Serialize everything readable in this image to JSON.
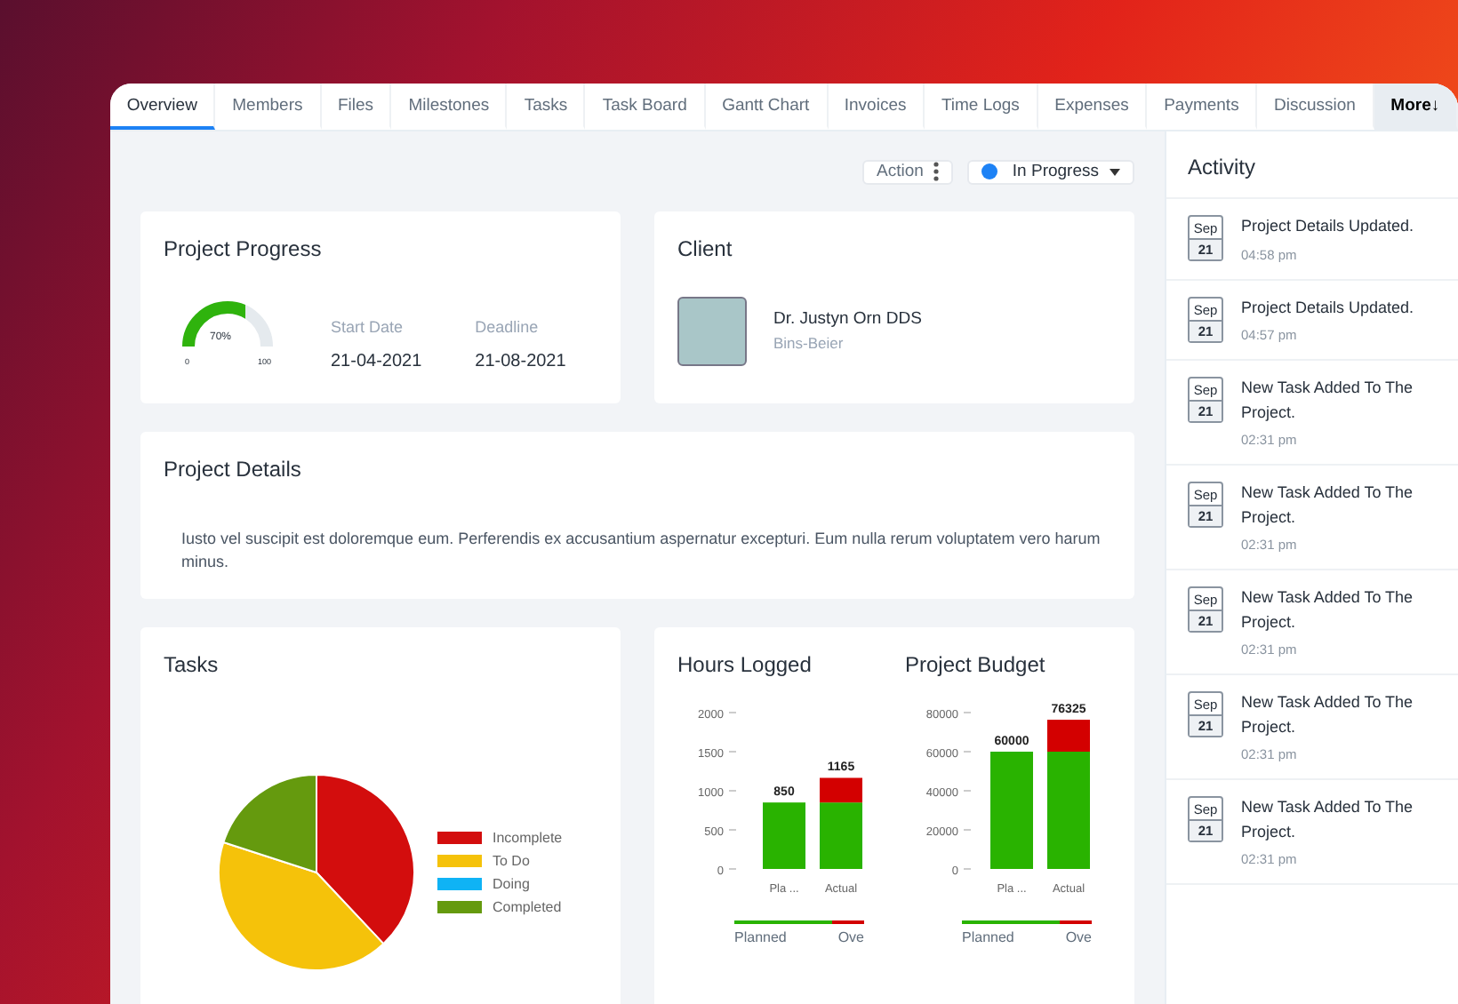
{
  "tabs": [
    {
      "label": "Overview",
      "selected": true
    },
    {
      "label": "Members",
      "selected": false
    },
    {
      "label": "Files",
      "selected": false
    },
    {
      "label": "Milestones",
      "selected": false
    },
    {
      "label": "Tasks",
      "selected": false
    },
    {
      "label": "Task Board",
      "selected": false
    },
    {
      "label": "Gantt Chart",
      "selected": false
    },
    {
      "label": "Invoices",
      "selected": false
    },
    {
      "label": "Time Logs",
      "selected": false
    },
    {
      "label": "Expenses",
      "selected": false
    },
    {
      "label": "Payments",
      "selected": false
    },
    {
      "label": "Discussion",
      "selected": false
    },
    {
      "label": "More↓",
      "selected": false,
      "kind": "more"
    }
  ],
  "action_button": "Action",
  "status": {
    "label": "In Progress",
    "color": "#1d82f5"
  },
  "progress": {
    "title": "Project Progress",
    "level": 0.7,
    "gauge_label": "70%",
    "gauge_min": "0",
    "gauge_max": "100",
    "dates": [
      {
        "label": "Start Date",
        "value": "21-04-2021"
      },
      {
        "label": "Deadline",
        "value": "21-08-2021"
      }
    ]
  },
  "client": {
    "title": "Client",
    "name": "Dr. Justyn Orn DDS",
    "company": "Bins-Beier"
  },
  "details": {
    "title": "Project Details",
    "text": "Iusto vel suscipit est doloremque eum. Perferendis ex accusantium aspernatur excepturi. Eum nulla rerum voluptatem vero harum minus."
  },
  "tasks": {
    "title": "Tasks",
    "legend": [
      {
        "label": "Incomplete",
        "color": "#d30d0d"
      },
      {
        "label": "To Do",
        "color": "#f5c20a"
      },
      {
        "label": "Doing",
        "color": "#0fb3f5"
      },
      {
        "label": "Completed",
        "color": "#659a0e"
      }
    ]
  },
  "charts": [
    {
      "title": "Hours Logged",
      "chart_data": {
        "type": "bar",
        "stacked": true,
        "categories": [
          "Pla ...",
          "Actual"
        ],
        "series": [
          {
            "name": "Planned",
            "color": "#29b300",
            "values": [
              850,
              850
            ]
          },
          {
            "name": "Ove",
            "color": "#d30000",
            "values": [
              0,
              315
            ]
          }
        ],
        "ylim": [
          0,
          2000
        ],
        "yticks": [
          0,
          500,
          1000,
          1500,
          2000
        ],
        "value_labels": [
          "850",
          "1165"
        ]
      }
    },
    {
      "title": "Project Budget",
      "chart_data": {
        "type": "bar",
        "stacked": true,
        "categories": [
          "Pla ...",
          "Actual"
        ],
        "series": [
          {
            "name": "Planned",
            "color": "#29b300",
            "values": [
              60000,
              60000
            ]
          },
          {
            "name": "Ove",
            "color": "#d30000",
            "values": [
              0,
              16325
            ]
          }
        ],
        "ylim": [
          0,
          80000
        ],
        "yticks": [
          0,
          20000,
          40000,
          60000,
          80000
        ],
        "value_labels": [
          "60000",
          "76325"
        ]
      }
    }
  ],
  "activity": {
    "title": "Activity",
    "items": [
      {
        "month": "Sep",
        "day": "21",
        "text": "Project Details Updated.",
        "time": "04:58 pm"
      },
      {
        "month": "Sep",
        "day": "21",
        "text": "Project Details Updated.",
        "time": "04:57 pm"
      },
      {
        "month": "Sep",
        "day": "21",
        "text": "New Task Added To The Project.",
        "time": "02:31 pm"
      },
      {
        "month": "Sep",
        "day": "21",
        "text": "New Task Added To The Project.",
        "time": "02:31 pm"
      },
      {
        "month": "Sep",
        "day": "21",
        "text": "New Task Added To The Project.",
        "time": "02:31 pm"
      },
      {
        "month": "Sep",
        "day": "21",
        "text": "New Task Added To The Project.",
        "time": "02:31 pm"
      },
      {
        "month": "Sep",
        "day": "21",
        "text": "New Task Added To The Project.",
        "time": "02:31 pm"
      }
    ]
  }
}
